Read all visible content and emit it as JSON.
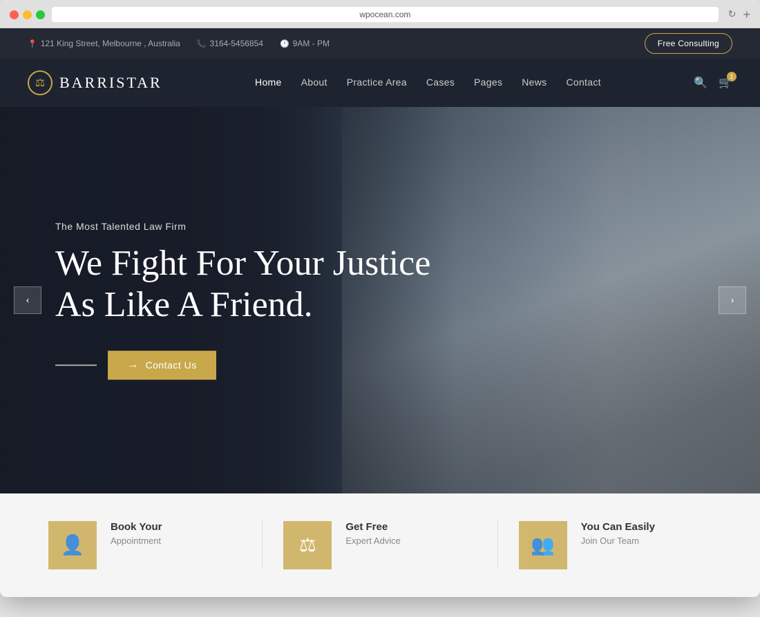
{
  "browser": {
    "url": "wpocean.com",
    "reload_icon": "↻",
    "new_tab_icon": "+"
  },
  "top_bar": {
    "address": "121 King Street, Melbourne , Australia",
    "phone": "3164-5456854",
    "hours": "9AM - PM",
    "address_icon": "📍",
    "phone_icon": "📞",
    "hours_icon": "🕐",
    "cta_label": "Free Consulting"
  },
  "navbar": {
    "logo_icon": "⚖",
    "logo_text": "BARRISTAR",
    "nav_items": [
      {
        "label": "Home",
        "active": true
      },
      {
        "label": "About",
        "active": false
      },
      {
        "label": "Practice Area",
        "active": false
      },
      {
        "label": "Cases",
        "active": false
      },
      {
        "label": "Pages",
        "active": false
      },
      {
        "label": "News",
        "active": false
      },
      {
        "label": "Contact",
        "active": false
      }
    ],
    "cart_count": "1"
  },
  "hero": {
    "subtitle": "The Most Talented Law Firm",
    "title_line1": "We Fight For Your Justice",
    "title_line2": "As Like A Friend.",
    "cta_label": "Contact Us",
    "arrow_left": "‹",
    "arrow_right": "›"
  },
  "features": [
    {
      "icon": "👤",
      "title": "Book Your",
      "subtitle": "Appointment"
    },
    {
      "icon": "⚖",
      "title": "Get Free",
      "subtitle": "Expert Advice"
    },
    {
      "icon": "👥",
      "title": "You Can Easily",
      "subtitle": "Join Our Team"
    }
  ]
}
